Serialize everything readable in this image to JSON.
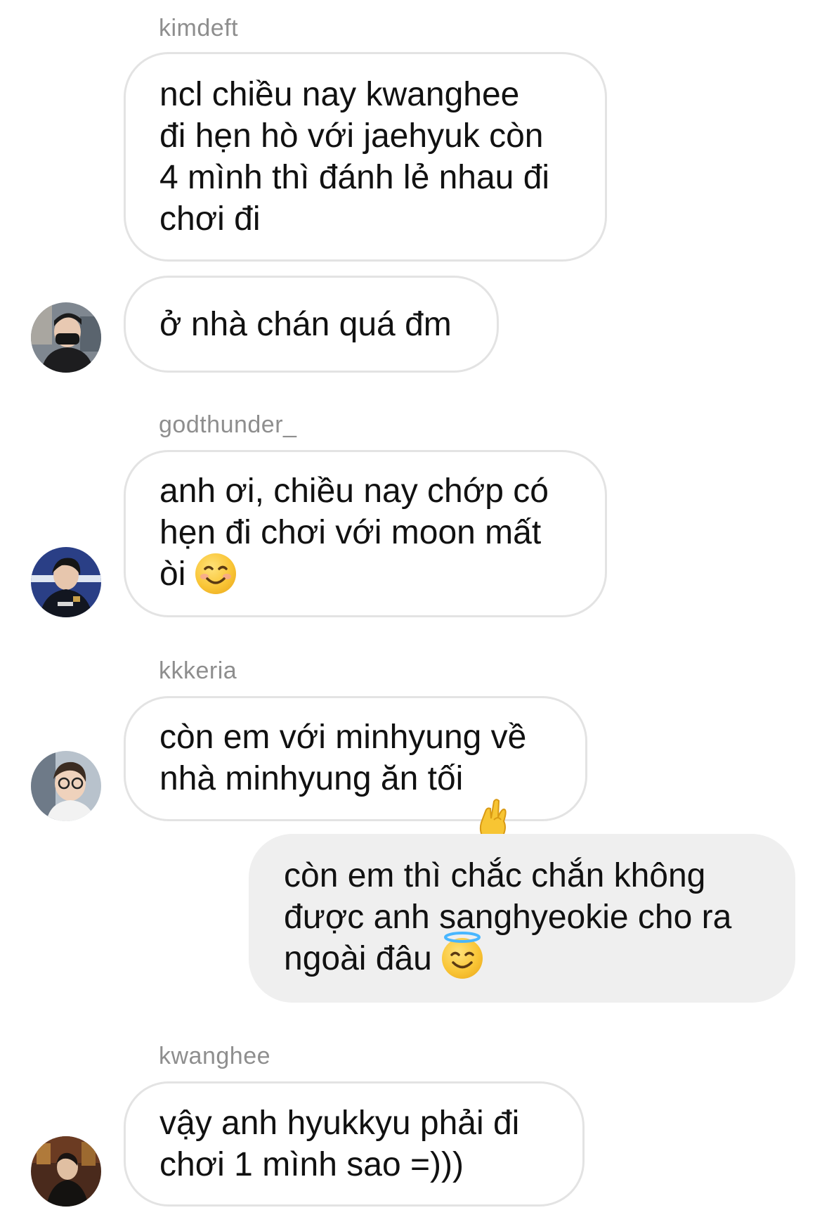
{
  "messages": [
    {
      "sender": "kimdeft",
      "text": "ncl chiều nay kwanghee\nđi hẹn hò với jaehyuk còn\n4 mình thì đánh lẻ nhau đi\nchơi đi"
    },
    {
      "text": "ở nhà chán quá đm"
    },
    {
      "sender": "godthunder_",
      "text": "anh ơi, chiều nay chớp có\nhẹn đi chơi với moon mất\nòi",
      "emoji": "smiling-face-icon"
    },
    {
      "sender": "kkkeria",
      "text": "còn em với minhyung về\nnhà minhyung ăn tối",
      "emoji": "crossed-fingers-icon"
    },
    {
      "text": "còn em thì chắc chắn không\nđược anh sanghyeokie cho ra\nngoài đâu",
      "emoji": "smiling-face-with-halo-icon",
      "outgoing": true
    },
    {
      "sender": "kwanghee",
      "text": "vậy anh hyukkyu phải đi\nchơi 1 mình sao =)))"
    }
  ],
  "colors": {
    "incoming_bubble_border": "#e3e3e3",
    "outgoing_bubble_bg": "#efefef",
    "sender_name": "#8e8e8e",
    "text": "#111111"
  }
}
